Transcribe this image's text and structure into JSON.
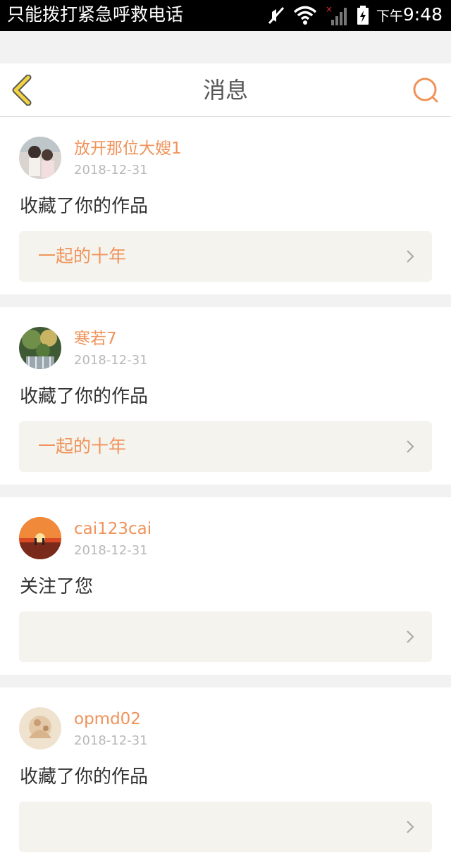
{
  "status_bar": {
    "carrier_text": "只能拨打紧急呼救电话",
    "time_prefix": "下午",
    "time": "9:48",
    "icons": [
      "mute-icon",
      "wifi-icon",
      "signal-icon",
      "battery-icon"
    ]
  },
  "header": {
    "title": "消息",
    "back_icon": "chevron-left-icon",
    "search_icon": "search-icon",
    "accent_color": "#f0935a",
    "back_color": "#f2d340"
  },
  "messages": [
    {
      "username": "放开那位大嫂1",
      "date": "2018-12-31",
      "action": "收藏了你的作品",
      "work_title": "一起的十年"
    },
    {
      "username": "寒若7",
      "date": "2018-12-31",
      "action": "收藏了你的作品",
      "work_title": "一起的十年"
    },
    {
      "username": "cai123cai",
      "date": "2018-12-31",
      "action": "关注了您",
      "work_title": ""
    },
    {
      "username": "opmd02",
      "date": "2018-12-31",
      "action": "收藏了你的作品",
      "work_title": ""
    }
  ]
}
